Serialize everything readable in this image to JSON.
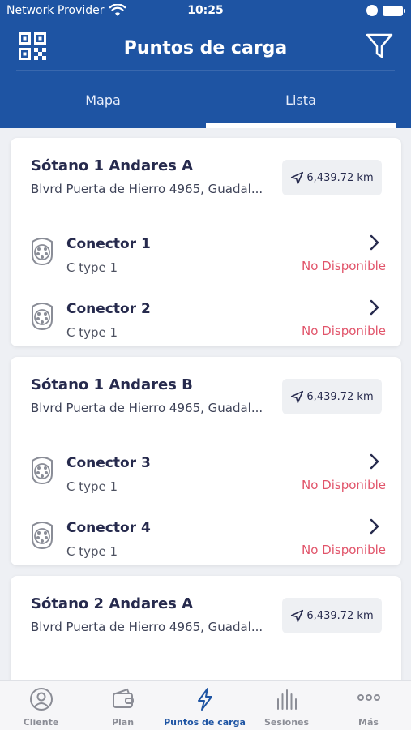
{
  "status_bar": {
    "carrier": "Network Provider",
    "time": "10:25"
  },
  "header": {
    "title": "Puntos de carga"
  },
  "tabs": [
    {
      "label": "Mapa",
      "selected": false
    },
    {
      "label": "Lista",
      "selected": true
    }
  ],
  "sites": [
    {
      "name": "Sótano 1 Andares A",
      "address": "Blvrd Puerta de Hierro 4965, Guadal...",
      "distance": "6,439.72 km",
      "connectors": [
        {
          "name": "Conector 1",
          "type": "C type 1",
          "status": "No Disponible"
        },
        {
          "name": "Conector 2",
          "type": "C type 1",
          "status": "No Disponible"
        }
      ]
    },
    {
      "name": "Sótano 1 Andares B",
      "address": "Blvrd Puerta de Hierro 4965, Guadal...",
      "distance": "6,439.72 km",
      "connectors": [
        {
          "name": "Conector 3",
          "type": "C type 1",
          "status": "No Disponible"
        },
        {
          "name": "Conector 4",
          "type": "C type 1",
          "status": "No Disponible"
        }
      ]
    },
    {
      "name": "Sótano 2 Andares A",
      "address": "Blvrd Puerta de Hierro 4965, Guadal...",
      "distance": "6,439.72 km",
      "connectors": []
    }
  ],
  "bottom_nav": [
    {
      "label": "Cliente",
      "icon": "person-icon",
      "active": false
    },
    {
      "label": "Plan",
      "icon": "wallet-icon",
      "active": false
    },
    {
      "label": "Puntos de carga",
      "icon": "lightning-icon",
      "active": true
    },
    {
      "label": "Sesiones",
      "icon": "bars-icon",
      "active": false
    },
    {
      "label": "Más",
      "icon": "more-dots-icon",
      "active": false
    }
  ],
  "colors": {
    "brand_blue": "#1e54a3",
    "status_unavailable": "#e1546a",
    "text_dark": "#262a4d"
  }
}
